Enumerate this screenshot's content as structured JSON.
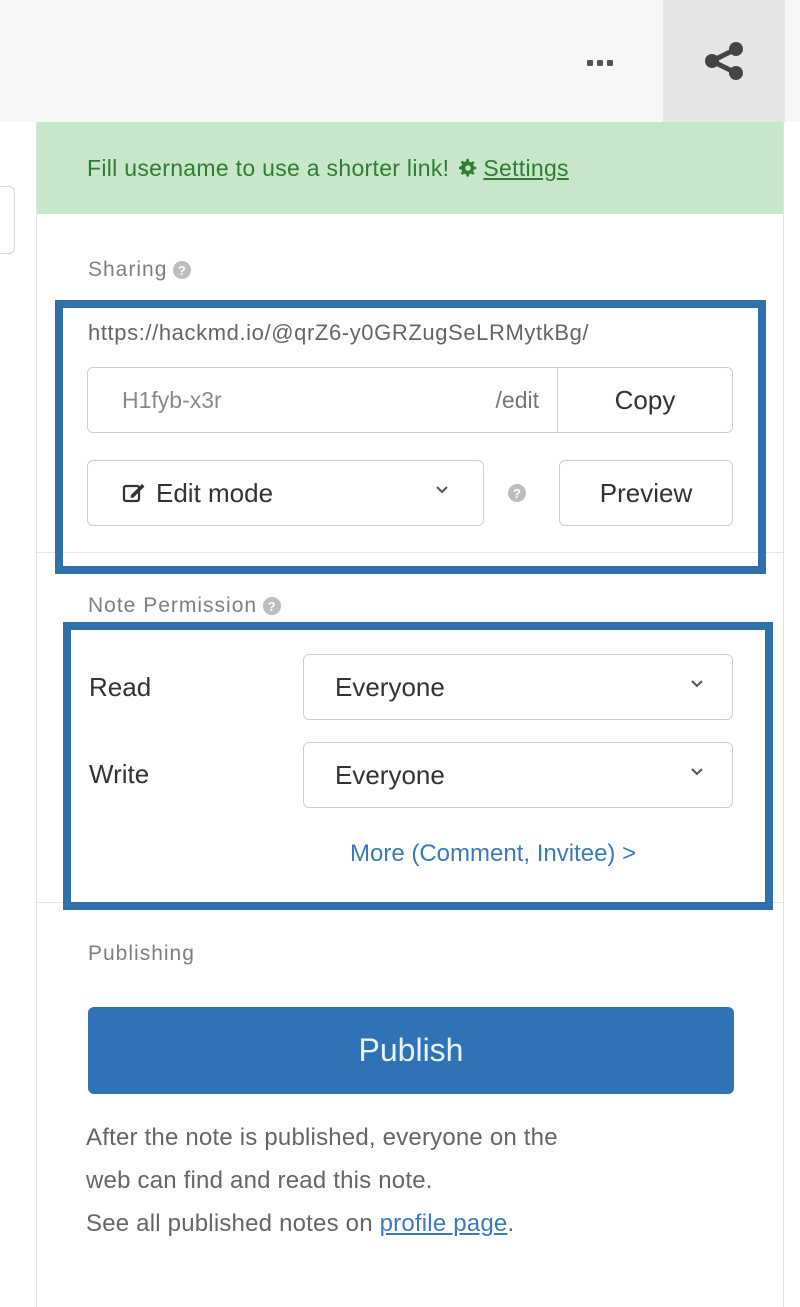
{
  "toolbar": {
    "more_icon": "ellipsis-icon",
    "share_icon": "share-icon"
  },
  "banner": {
    "text": "Fill username to use a shorter link!",
    "settings_label": "Settings",
    "settings_icon": "gear-icon"
  },
  "sharing": {
    "section_label": "Sharing",
    "url": "https://hackmd.io/@qrZ6-y0GRZugSeLRMytkBg/",
    "link_value": "H1fyb-x3r",
    "link_suffix": "/edit",
    "copy_label": "Copy",
    "mode_label": "Edit mode",
    "preview_label": "Preview"
  },
  "permission": {
    "section_label": "Note Permission",
    "read_label": "Read",
    "read_value": "Everyone",
    "write_label": "Write",
    "write_value": "Everyone",
    "more_link": "More (Comment, Invitee) >"
  },
  "publishing": {
    "section_label": "Publishing",
    "publish_label": "Publish",
    "note_line1": "After the note is published, everyone on the",
    "note_line2": "web can find and read this note.",
    "note_line3_prefix": "See all published notes on ",
    "profile_link": "profile page",
    "note_line3_suffix": "."
  },
  "colors": {
    "banner_bg": "#c8e6c9",
    "banner_text": "#2e7d32",
    "primary": "#2f72b6",
    "link": "#3a7bbd",
    "highlight_border": "#2f6fae"
  }
}
